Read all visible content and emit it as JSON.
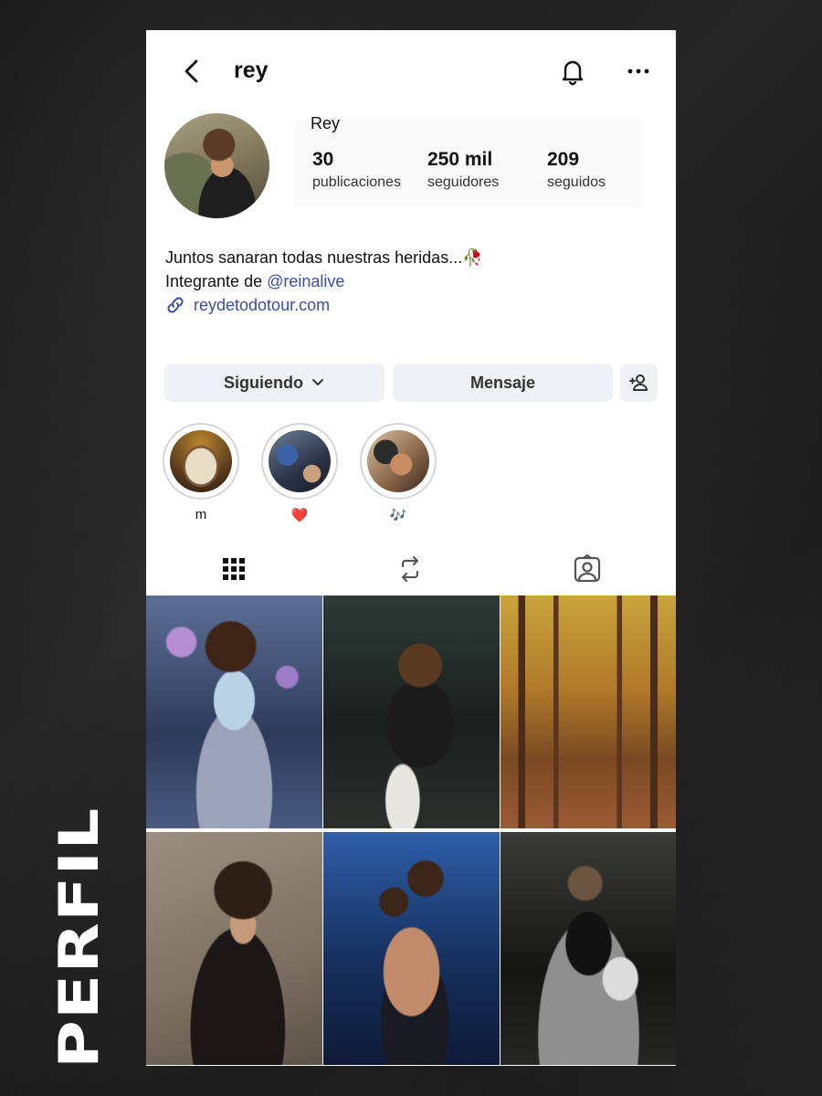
{
  "header": {
    "username": "rey"
  },
  "profile": {
    "display_name": "Rey",
    "stats": [
      {
        "value": "30",
        "label": "publicaciones"
      },
      {
        "value": "250 mil",
        "label": "seguidores"
      },
      {
        "value": "209",
        "label": "seguidos"
      }
    ],
    "bio_line1": "Juntos sanaran todas nuestras heridas...🥀",
    "bio_line2_prefix": "Integrante de ",
    "bio_mention": "@reinalive",
    "link": "reydetodotour.com"
  },
  "actions": {
    "following_label": "Siguiendo",
    "message_label": "Mensaje"
  },
  "highlights": [
    {
      "label": "m"
    },
    {
      "label": "❤️"
    },
    {
      "label": "🎶"
    }
  ],
  "side_caption": "PERFIL",
  "colors": {
    "link": "#3a4ea6",
    "button_bg": "#eff1f5"
  }
}
